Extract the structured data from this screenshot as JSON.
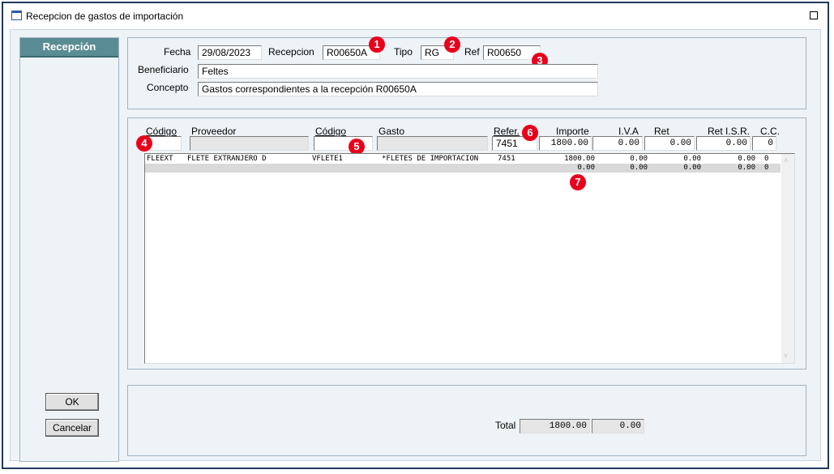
{
  "window": {
    "title": "Recepcion de gastos de importación"
  },
  "sidebar": {
    "tab_label": "Recepción",
    "ok_label": "OK",
    "cancel_label": "Cancelar"
  },
  "header": {
    "fecha_label": "Fecha",
    "fecha_value": "29/08/2023",
    "recepcion_label": "Recepcion",
    "recepcion_value": "R00650A",
    "tipo_label": "Tipo",
    "tipo_value": "RG",
    "ref_label": "Ref",
    "ref_value": "R00650",
    "beneficiario_label": "Beneficiario",
    "beneficiario_value": "Feltes",
    "concepto_label": "Concepto",
    "concepto_value": "Gastos correspondientes a la recepción R00650A"
  },
  "detail": {
    "headers": {
      "codigo_prov": "Código",
      "proveedor": "Proveedor",
      "codigo_gasto": "Código",
      "gasto": "Gasto",
      "refer": "Refer.",
      "importe": "Importe",
      "iva": "I.V.A",
      "ret": "Ret",
      "ret_isr": "Ret I.S.R.",
      "cc": "C.C."
    },
    "inputs": {
      "codigo_prov": "",
      "proveedor": "",
      "codigo_gasto": "",
      "gasto": "",
      "refer": "7451",
      "importe": "1800.00",
      "iva": "0.00",
      "ret": "0.00",
      "ret_isr": "0.00",
      "cc": "0"
    },
    "rows": [
      {
        "codigo_prov": "FLEEXT",
        "proveedor": "FLETE EXTRANJERO D",
        "codigo_gasto": "VFLETE1",
        "gasto": "*FLETES DE IMPORTACION",
        "refer": "7451",
        "importe": "1800.00",
        "iva": "0.00",
        "ret": "0.00",
        "ret_isr": "0.00",
        "cc": "0"
      },
      {
        "codigo_prov": "",
        "proveedor": "",
        "codigo_gasto": "",
        "gasto": "",
        "refer": "",
        "importe": "0.00",
        "iva": "0.00",
        "ret": "0.00",
        "ret_isr": "0.00",
        "cc": "0"
      }
    ]
  },
  "totals": {
    "label": "Total",
    "importe": "1800.00",
    "iva": "0.00"
  },
  "markers": [
    "1",
    "2",
    "3",
    "4",
    "5",
    "6",
    "7"
  ],
  "colors": {
    "tab_bg": "#5a8c93",
    "marker": "#e8001c",
    "frame": "#1f3a5c"
  }
}
